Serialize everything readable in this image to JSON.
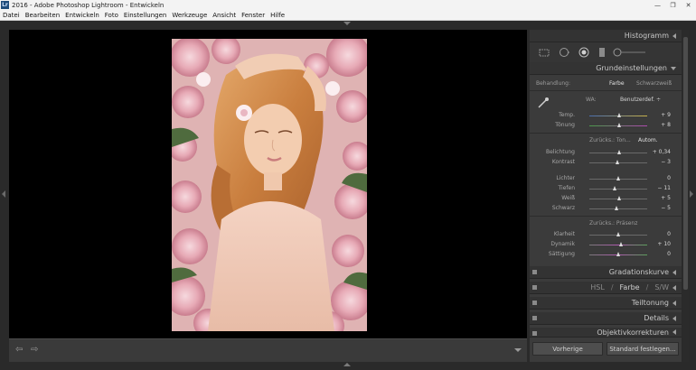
{
  "window": {
    "title": "2016 - Adobe Photoshop Lightroom - Entwickeln",
    "app_icon": "Lr",
    "controls": [
      "—",
      "❐",
      "✕"
    ]
  },
  "menu": [
    "Datei",
    "Bearbeiten",
    "Entwickeln",
    "Foto",
    "Einstellungen",
    "Werkzeuge",
    "Ansicht",
    "Fenster",
    "Hilfe"
  ],
  "panel": {
    "histogram": "Histogramm",
    "basic": {
      "header": "Grundeinstellungen",
      "treatment_label": "Behandlung:",
      "treatment_color": "Farbe",
      "treatment_bw": "Schwarzweiß",
      "wb_label": "WA:",
      "wb_value": "Benutzerdef. ÷",
      "temp_label": "Temp.",
      "temp_value": "+ 9",
      "tint_label": "Tönung",
      "tint_value": "+ 8",
      "tone_reset": "Zurücks.: Ton...",
      "tone_auto": "Autom.",
      "exposure_label": "Belichtung",
      "exposure_value": "+ 0,34",
      "contrast_label": "Kontrast",
      "contrast_value": "− 3",
      "highlights_label": "Lichter",
      "highlights_value": "0",
      "shadows_label": "Tiefen",
      "shadows_value": "− 11",
      "whites_label": "Weiß",
      "whites_value": "+ 5",
      "blacks_label": "Schwarz",
      "blacks_value": "− 5",
      "presence_reset": "Zurücks.: Präsenz",
      "clarity_label": "Klarheit",
      "clarity_value": "0",
      "vibrance_label": "Dynamik",
      "vibrance_value": "+ 10",
      "saturation_label": "Sättigung",
      "saturation_value": "0"
    },
    "tone_curve": "Gradationskurve",
    "hsl": "HSL",
    "hsl_sep": "/",
    "color": "Farbe",
    "bw": "S/W",
    "split_toning": "Teiltonung",
    "details": "Details",
    "lens": "Objektivkorrekturen",
    "btn_previous": "Vorherige",
    "btn_default": "Standard festlegen..."
  },
  "sliders": {
    "temp": 0.53,
    "tint": 0.53,
    "exposure": 0.53,
    "contrast": 0.49,
    "highlights": 0.5,
    "shadows": 0.45,
    "whites": 0.52,
    "blacks": 0.48,
    "clarity": 0.5,
    "vibrance": 0.55,
    "saturation": 0.5
  },
  "colors": {
    "accent": "#dcdcdc",
    "panel_bg": "#3b3b3b",
    "header_bg": "#333333"
  },
  "icons": [
    "crop-overlay-icon",
    "spot-removal-icon",
    "red-eye-icon",
    "graduated-filter-icon",
    "adjustment-brush-icon",
    "eyedropper-icon",
    "arrow-left-icon",
    "arrow-right-icon"
  ]
}
